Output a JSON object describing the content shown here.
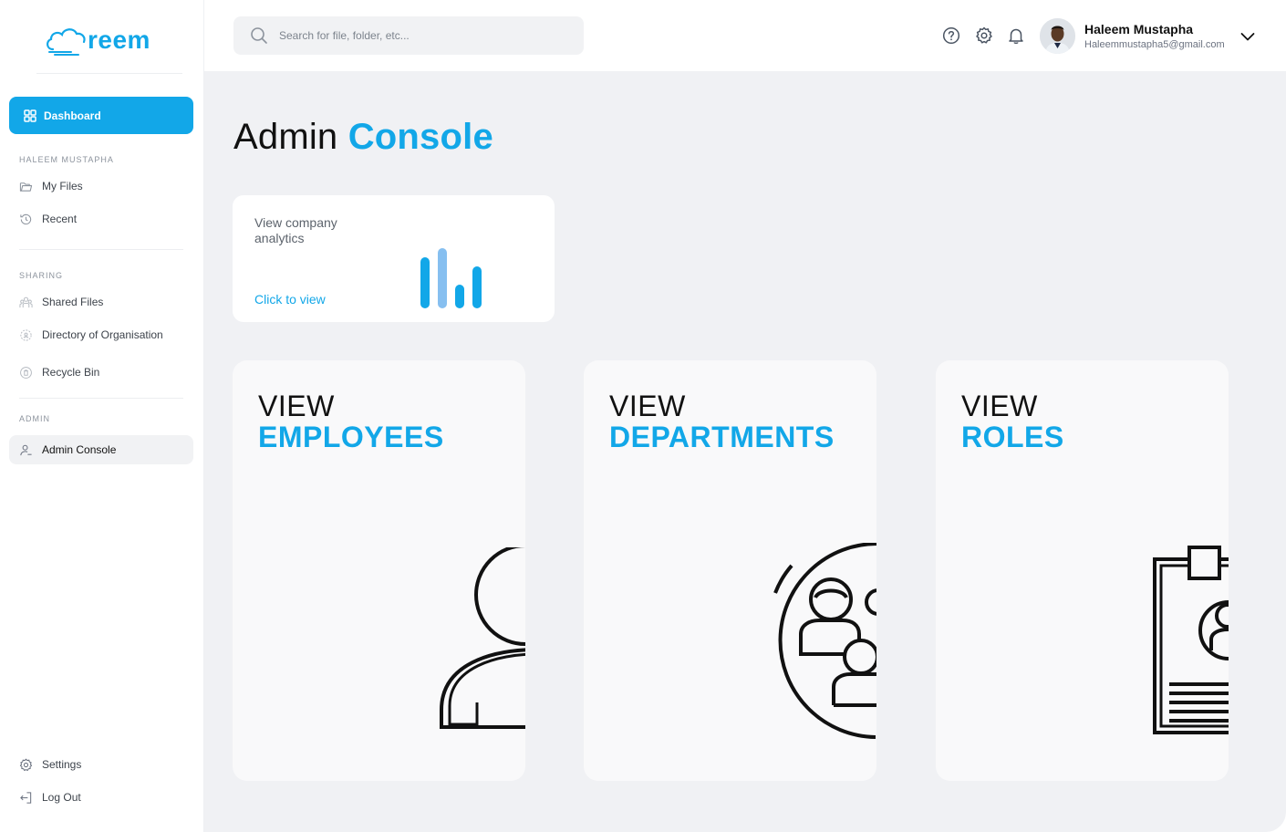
{
  "app": {
    "logo_text": "reem",
    "brand_color": "#12a7e8"
  },
  "sidebar": {
    "dashboard_label": "Dashboard",
    "section_user": "HALEEM MUSTAPHA",
    "my_files": "My Files",
    "recent": "Recent",
    "section_sharing": "SHARING",
    "shared_files": "Shared Files",
    "directory": "Directory of Organisation",
    "recycle_bin": "Recycle Bin",
    "section_admin": "ADMIN",
    "admin_console": "Admin Console",
    "settings": "Settings",
    "logout": "Log Out"
  },
  "header": {
    "search_placeholder": "Search for file, folder, etc...",
    "user_name": "Haleem Mustapha",
    "user_email": "Haleemmustapha5@gmail.com",
    "icons": [
      "help-icon",
      "gear-icon",
      "bell-icon",
      "chevron-down-icon"
    ]
  },
  "main": {
    "title_part1": "Admin ",
    "title_part2": "Console",
    "analytics": {
      "title": "View company analytics",
      "link": "Click to view"
    },
    "cards": [
      {
        "line1": "VIEW",
        "line2": "EMPLOYEES",
        "icon": "person-icon"
      },
      {
        "line1": "VIEW",
        "line2": "DEPARTMENTS",
        "icon": "group-icon"
      },
      {
        "line1": "VIEW",
        "line2": "ROLES",
        "icon": "id-badge-icon"
      }
    ]
  }
}
